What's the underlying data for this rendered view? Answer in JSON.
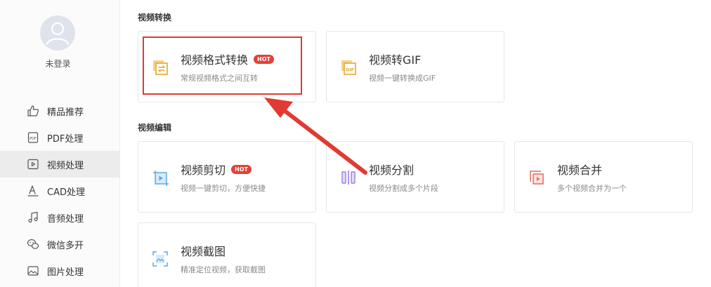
{
  "user": {
    "login_text": "未登录"
  },
  "sidebar": {
    "items": [
      {
        "label": "精品推荐",
        "icon": "thumb-up-icon"
      },
      {
        "label": "PDF处理",
        "icon": "pdf-icon"
      },
      {
        "label": "视频处理",
        "icon": "video-play-icon",
        "active": true
      },
      {
        "label": "CAD处理",
        "icon": "cad-icon"
      },
      {
        "label": "音频处理",
        "icon": "music-note-icon"
      },
      {
        "label": "微信多开",
        "icon": "wechat-icon"
      },
      {
        "label": "图片处理",
        "icon": "image-icon"
      }
    ]
  },
  "sections": {
    "convert": {
      "title": "视频转换",
      "cards": [
        {
          "title": "视频格式转换",
          "desc": "常规视频格式之间互转",
          "badge": "HOT",
          "icon": "format-convert-icon"
        },
        {
          "title": "视频转GIF",
          "desc": "视频一键转换成GIF",
          "icon": "gif-icon"
        }
      ]
    },
    "edit": {
      "title": "视频编辑",
      "cards": [
        {
          "title": "视频剪切",
          "desc": "视频一键剪切，方便快捷",
          "badge": "HOT",
          "icon": "video-cut-icon"
        },
        {
          "title": "视频分割",
          "desc": "视频分割成多个片段",
          "icon": "video-split-icon"
        },
        {
          "title": "视频合并",
          "desc": "多个视频合并为一个",
          "icon": "video-merge-icon"
        },
        {
          "title": "视频截图",
          "desc": "精准定位视频，获取截图",
          "icon": "video-screenshot-icon"
        }
      ]
    }
  },
  "colors": {
    "accent_red": "#e03a33",
    "hot_badge": "#e24236",
    "icon_orange": "#e5a62c",
    "icon_blue": "#5aa9e6",
    "icon_purple": "#9b7ee0",
    "icon_red": "#e56a5e"
  }
}
